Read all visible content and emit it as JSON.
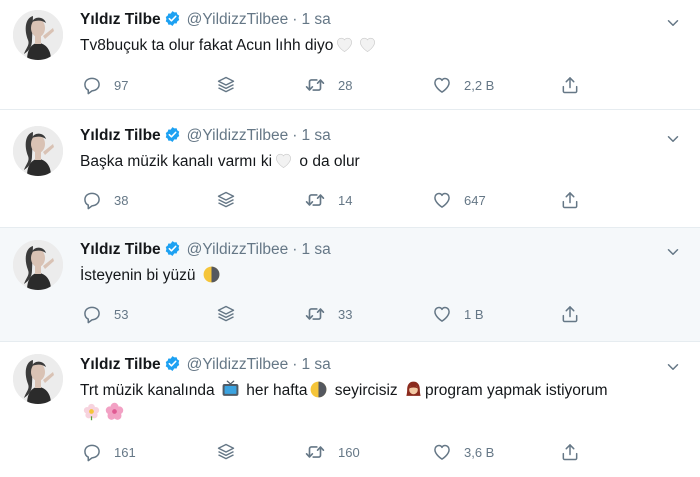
{
  "user": {
    "name": "Yıldız Tilbe",
    "handle": "@YildizzTilbee"
  },
  "sep": "·",
  "tweets": [
    {
      "time": "1 sa",
      "text1": "Tv8buçuk ta olur fakat Acun lıhh diyo",
      "replies": "97",
      "retweets": "28",
      "likes": "2,2 B"
    },
    {
      "time": "1 sa",
      "text1": "Başka müzik kanalı varmı ki",
      "text2": " o da olur",
      "replies": "38",
      "retweets": "14",
      "likes": "647"
    },
    {
      "time": "1 sa",
      "text1": "İsteyenin bi yüzü",
      "replies": "53",
      "retweets": "33",
      "likes": "1 B"
    },
    {
      "time": "1 sa",
      "text1": "Trt müzik kanalında ",
      "text2": " her hafta",
      "text3": " seyircisiz ",
      "text4": "program yapmak istiyorum",
      "replies": "161",
      "retweets": "160",
      "likes": "3,6 B"
    }
  ],
  "icons": {
    "reply": "reply-icon",
    "stack": "stack-icon",
    "retweet": "retweet-icon",
    "like": "heart-icon",
    "share": "share-icon",
    "caret": "chevron-down-icon",
    "verified": "verified-badge-icon"
  },
  "colors": {
    "verified": "#1da1f2",
    "muted": "#657786",
    "divider": "#e6ecf0",
    "highlight_bg": "#f5f8fa"
  }
}
